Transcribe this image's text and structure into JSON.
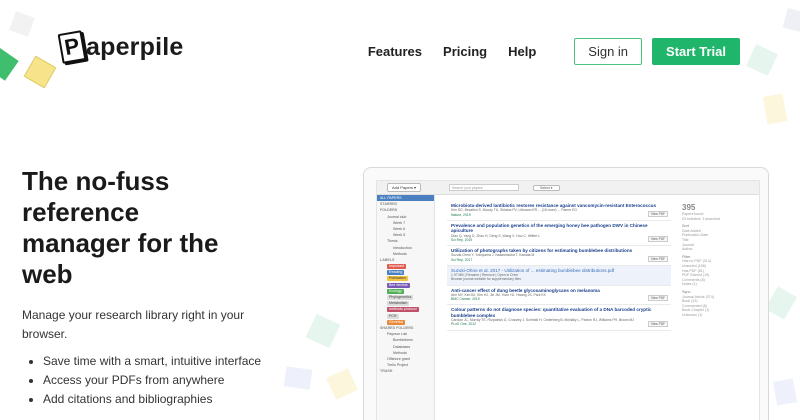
{
  "brand": {
    "logo_mark": "P",
    "logo_text": "aperpile"
  },
  "nav": {
    "features": "Features",
    "pricing": "Pricing",
    "help": "Help",
    "signin": "Sign in",
    "trial": "Start Trial"
  },
  "hero": {
    "title": "The no-fuss reference manager for the web",
    "description": "Manage your research library right in your browser.",
    "bullets": [
      "Save time with a smart, intuitive interface",
      "Access your PDFs from anywhere",
      "Add citations and bibliographies"
    ]
  },
  "app": {
    "add_papers": "Add Papers ▾",
    "search_placeholder": "Search your papers",
    "select": "Select ▾",
    "sidebar": {
      "all_papers": "ALL PAPERS",
      "starred": "STARRED",
      "folders": "FOLDERS",
      "journal_club": "Journal club",
      "week7": "Week 7",
      "week6": "Week 6",
      "week5": "Week 5",
      "thesis": "Thesis",
      "introduction": "Introduction",
      "methods": "Methods",
      "labels": "LABELS",
      "important": "Important",
      "reading": "Reading",
      "pollination": "Pollination",
      "bee_decline": "Bee decline",
      "ecology": "Ecology",
      "phylogenetics": "Phylogenetics",
      "metabolism": "Metabolism",
      "methods_protocol": "methods protocol",
      "pcr": "PCR",
      "genetics": "Genetics",
      "shared_folders": "SHARED FOLDERS",
      "paymon_lab": "Paymon Lab",
      "bumblebees": "Bumblebees",
      "databases": "Databases",
      "methods2": "Methods",
      "offshore_grant": "Offshore grant",
      "trello_project": "Trello Project",
      "trash": "TRASH"
    },
    "papers": [
      {
        "title": "Microbiota-derived lantibiotic restores resistance against vancomycin-resistant Enterococcus",
        "authors": "Kim SG, Becattini S, Moody TU, Shliaha PV, Littmann ER ... (15 more) ... Pamer EG",
        "journal": "Nature, 2019"
      },
      {
        "title": "Prevalence and population genetics of the emerging honey bee pathogen DWV in Chinese apiculture",
        "authors": "Diao Q, Yang D, Zhao H, Deng S, Wang X, Hou C, Wilfert L",
        "journal": "Sci Rep, 2019"
      },
      {
        "title": "Utilization of photographs taken by citizens for estimating bumblebee distributions",
        "authors": "Suzuki-Ohno Y, Yokoyama J, Nakashizuka T, Kawata M",
        "journal": "Sci Rep, 2017"
      },
      {
        "title": "Suzuki-Ohno et al. 2017 - Utilization of ... estimating bumblebee distributions.pdf",
        "authors": "1.97 MB | Rename | Remove | Open in Drive",
        "journal": "Browse journal website for supplementary files"
      },
      {
        "title": "Anti-cancer effect of dung beetle glycosaminoglycans on melanoma",
        "authors": "Ahn MY, Kim BJ, Kim HJ, Jin JM, Yoon HJ, Hwang JS, Park KK",
        "journal": "BMC Cancer, 2019"
      },
      {
        "title": "Colour patterns do not diagnose species: quantitative evaluation of a DNA barcoded cryptic bumblebee complex",
        "authors": "Carolan JC, Murray TE, Fitzpatrick Ú, Crossley J, Schmidt H, Cederberg B, McNally L, Paxton RJ, Williams PH, Brown MJ",
        "journal": "PLoS One, 2012"
      }
    ],
    "view_pdf": "View PDF",
    "right_pane": {
      "count": "395",
      "count_label": "Papers found",
      "count_sub": "23 selected, 3 searched",
      "sort": "Sort",
      "sort_items": [
        "Date Added",
        "Publication Date",
        "Title",
        "Journal",
        "Author"
      ],
      "filter": "Filter",
      "filter_items": [
        "Has no PDF (314)",
        "Unsorted (158)",
        "Has PDF (81)",
        "PDF Starred (19)",
        "Comments (8)",
        "Notes (1)"
      ],
      "sync": "Sync",
      "sync_items": [
        "Journal Article (374)",
        "Book (13)",
        "Commented (8)",
        "Book Chapter (1)",
        "Unknown (1)"
      ]
    }
  },
  "colors": {
    "brand_green": "#1fb56b",
    "sidebar_active": "#4a7fc1",
    "paper_title": "#1a3f8c"
  }
}
